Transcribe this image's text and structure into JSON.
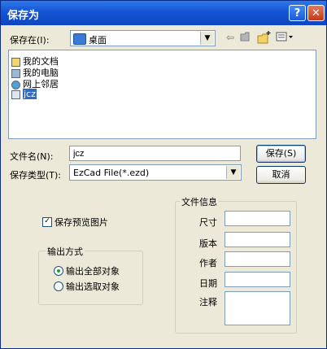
{
  "window": {
    "title": "保存为",
    "help_label": "?",
    "close_label": "✕"
  },
  "save_in": {
    "label": "保存在(I):",
    "value": "桌面"
  },
  "toolbar": {
    "back_icon": "back-arrow-icon",
    "up_icon": "up-folder-icon",
    "new_icon": "new-folder-icon",
    "view_icon": "view-menu-icon"
  },
  "files": [
    {
      "name": "我的文档",
      "icon": "my-documents-icon"
    },
    {
      "name": "我的电脑",
      "icon": "my-computer-icon"
    },
    {
      "name": "网上邻居",
      "icon": "network-places-icon"
    },
    {
      "name": "jcz",
      "icon": "file-icon",
      "selected": true
    }
  ],
  "filename": {
    "label": "文件名(N):",
    "value": "jcz"
  },
  "filetype": {
    "label": "保存类型(T):",
    "value": "EzCad File(*.ezd)"
  },
  "buttons": {
    "save": "保存(S)",
    "cancel": "取消"
  },
  "options": {
    "preview_label": "保存预览图片",
    "preview_checked": true,
    "output_legend": "输出方式",
    "output_all": "输出全部对象",
    "output_selected": "输出选取对象",
    "selected_option": "all"
  },
  "file_info": {
    "legend": "文件信息",
    "size_label": "尺寸",
    "version_label": "版本",
    "author_label": "作者",
    "date_label": "日期",
    "comment_label": "注释"
  }
}
